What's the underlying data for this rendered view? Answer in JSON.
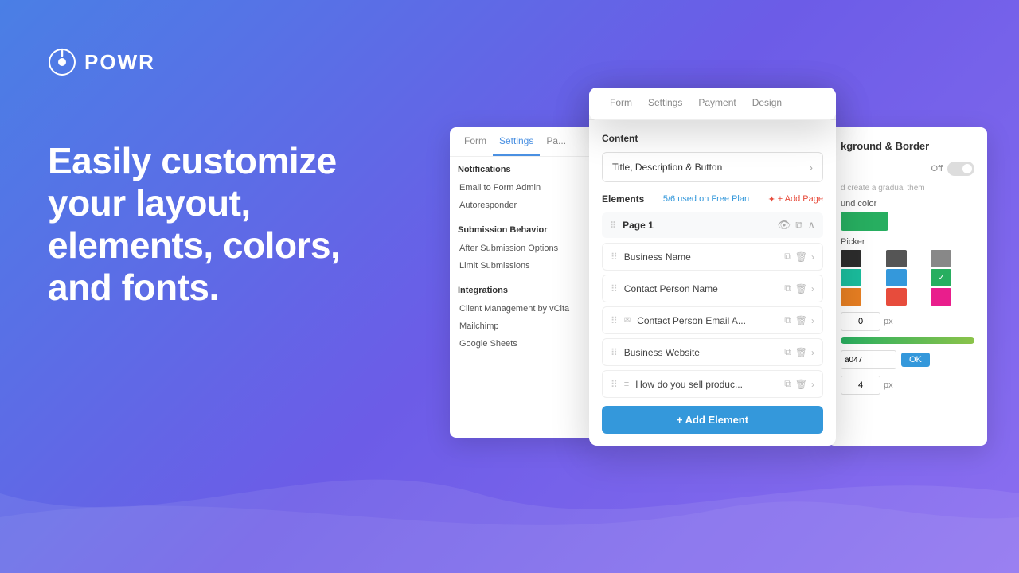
{
  "brand": {
    "logo_text": "POWR",
    "tagline": "Easily customize your layout, elements, colors, and fonts."
  },
  "top_panel": {
    "tabs": [
      "Form",
      "Settings",
      "Payment",
      "Design"
    ]
  },
  "settings_panel": {
    "tabs": [
      "Form",
      "Settings",
      "Pa..."
    ],
    "sections": [
      {
        "title": "Notifications",
        "items": [
          "Email to Form Admin",
          "Autoresponder"
        ]
      },
      {
        "title": "Submission Behavior",
        "items": [
          "After Submission Options",
          "Limit Submissions"
        ]
      },
      {
        "title": "Integrations",
        "items": [
          "Client Management by vCita",
          "Mailchimp",
          "Google Sheets"
        ]
      }
    ]
  },
  "form_panel": {
    "tabs": [
      "Form",
      "Settings",
      "Payment",
      "Design"
    ],
    "active_tab": "Form",
    "content_label": "Content",
    "title_btn": "Title, Description & Button",
    "elements_label": "Elements",
    "elements_count": "5/6 used on Free Plan",
    "add_page_label": "+ Add Page",
    "page_label": "Page 1",
    "elements": [
      {
        "label": "Business Name",
        "has_extra_icon": false
      },
      {
        "label": "Contact Person Name",
        "has_extra_icon": false
      },
      {
        "label": "Contact Person Email A...",
        "has_extra_icon": false
      },
      {
        "label": "Business Website",
        "has_extra_icon": false
      },
      {
        "label": "How do you sell produc...",
        "has_extra_icon": true
      }
    ],
    "add_element_btn": "+ Add Element"
  },
  "bg_border_panel": {
    "title": "kground & Border",
    "toggle_label": "Off",
    "hint": "d create a gradual them",
    "color_label": "und color",
    "picker_label": "Picker",
    "palette": [
      {
        "color": "#2c2c2c",
        "class": "c-dark"
      },
      {
        "color": "#555",
        "class": "c-darkgray"
      },
      {
        "color": "#888",
        "class": "c-gray"
      },
      {
        "color": "#1abc9c",
        "class": "c-teal"
      },
      {
        "color": "#3498db",
        "class": "c-blue"
      },
      {
        "color": "#27ae60",
        "class": "c-check"
      },
      {
        "color": "#e67e22",
        "class": "c-orange"
      },
      {
        "color": "#e74c3c",
        "class": "c-red"
      },
      {
        "color": "#e91e8c",
        "class": "c-pink"
      }
    ],
    "px_value": "0",
    "hex_value": "a047",
    "ok_label": "OK",
    "px_value2": "4"
  }
}
